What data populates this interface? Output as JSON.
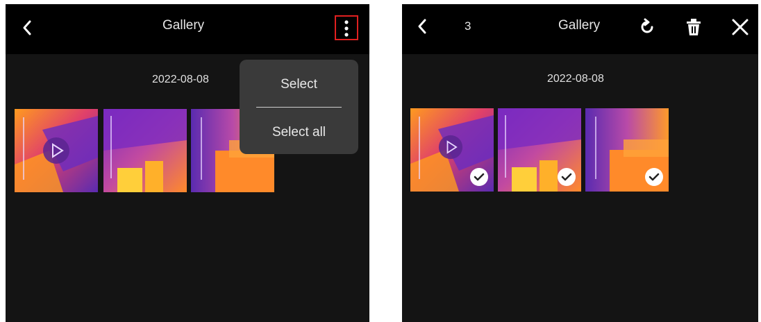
{
  "left_screen": {
    "title": "Gallery",
    "date": "2022-08-08",
    "menu": {
      "items": [
        "Select",
        "Select all"
      ]
    },
    "icons": {
      "back": "chevron-left-icon",
      "more": "more-vertical-icon"
    }
  },
  "right_screen": {
    "title": "Gallery",
    "selected_count": "3",
    "date": "2022-08-08",
    "icons": {
      "back": "chevron-left-icon",
      "rotate": "rotate-icon",
      "delete": "trash-icon",
      "close": "close-icon"
    }
  },
  "colors": {
    "highlight": "#e02020",
    "thermal_hot": "#ff9a1f",
    "thermal_mid": "#c24aa0",
    "thermal_cold": "#5a2bb0"
  }
}
